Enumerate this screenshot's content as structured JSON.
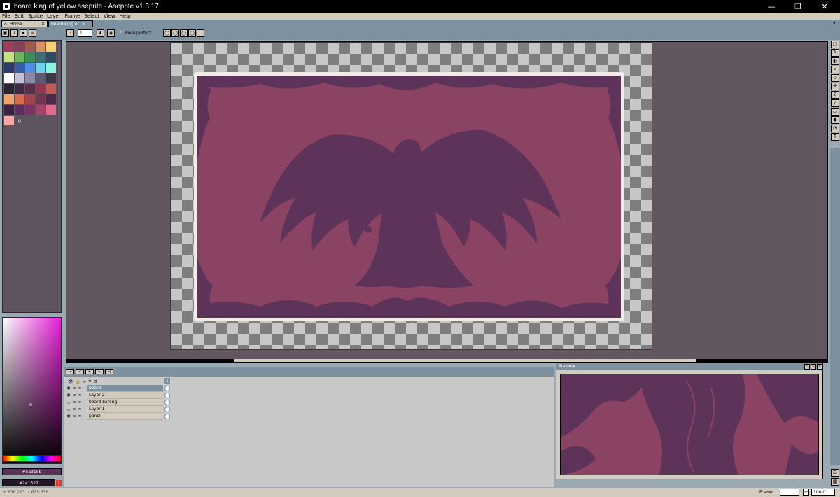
{
  "window": {
    "title": "board king of yellow.aseprite - Aseprite v1.3.17",
    "controls": [
      "—",
      "❐",
      "✕"
    ]
  },
  "menu": [
    "File",
    "Edit",
    "Sprite",
    "Layer",
    "Frame",
    "Select",
    "View",
    "Help"
  ],
  "tabs": [
    {
      "label": "Home",
      "close": "✕"
    },
    {
      "label": "board king of",
      "close": "×"
    }
  ],
  "toolbar": {
    "brush_size": "1",
    "pixel_perfect_label": "Pixel-perfect",
    "pixel_perfect_check": "✓",
    "more": "..."
  },
  "palette": {
    "colors": [
      "#a33a5c",
      "#824257",
      "#a05a4f",
      "#d99263",
      "#f6d075",
      "#c4e37f",
      "#6fb45d",
      "#3a8d55",
      "#3e6f72",
      "#2d4c63",
      "#2b3b6d",
      "#345ea6",
      "#4f8ee4",
      "#6fd3f0",
      "#8ef2e0",
      "#ffffff",
      "#c3bfd6",
      "#8d8aa6",
      "#5d5a73",
      "#3a384a",
      "#2a2334",
      "#3e2a44",
      "#5a2d48",
      "#8a3a4f",
      "#c25a55",
      "#eda36a",
      "#d26b4f",
      "#a3434b",
      "#73354b",
      "#4d2a4a",
      "#3b2148",
      "#5a2e5d",
      "#7b3461",
      "#a7416e",
      "#e26b8d",
      "#f5a7a7"
    ],
    "index_label": "0"
  },
  "colors": {
    "fg": "#5a3158",
    "fg_label": "#5a315b",
    "bg": "#241527",
    "bg_label": "#241527",
    "warn": "!"
  },
  "timeline": {
    "frame_number": "1",
    "layers": [
      {
        "name": "board",
        "selected": true
      },
      {
        "name": "Layer 2",
        "selected": false
      },
      {
        "name": "board barong",
        "selected": false
      },
      {
        "name": "Layer 1",
        "selected": false
      },
      {
        "name": "panel",
        "selected": false
      }
    ],
    "eye": "👁",
    "lock": "🔒",
    "link": "∞"
  },
  "preview": {
    "title": "Preview"
  },
  "status": {
    "coords": "+ 836 223 ⊡ 625 536",
    "frame_label": "Frame:",
    "frame_plus": "+",
    "zoom": "100.0"
  },
  "tools": [
    "⬚",
    "✎",
    "◐",
    "⌕",
    "⊹",
    "✛",
    "⊘",
    "╱",
    "▭",
    "◆",
    "◔",
    "T"
  ]
}
